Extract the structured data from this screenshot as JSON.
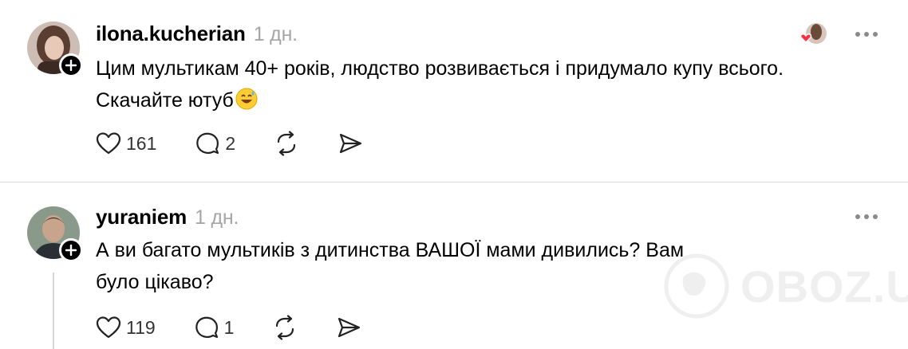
{
  "posts": [
    {
      "username": "ilona.kucherian",
      "time": "1 дн.",
      "text_line1": "Цим мультикам 40+ років, людство розвивається і придумало купу всього.",
      "text_line2": "Скачайте ютуб",
      "likes": "161",
      "replies": "2",
      "avatar_icon": "profile-photo-woman"
    },
    {
      "username": "yuraniem",
      "time": "1 дн.",
      "text_line1": "А ви багато мультиків з дитинства ВАШОЇ мами дивились? Вам",
      "text_line2": "було цікаво?",
      "likes": "119",
      "replies": "1",
      "avatar_icon": "profile-photo-man"
    }
  ],
  "watermark": {
    "text": "OBOZ.UA"
  },
  "colors": {
    "like_heart": "#ff3040",
    "muted": "#a6a6a6",
    "divider": "#dcdcdc"
  }
}
